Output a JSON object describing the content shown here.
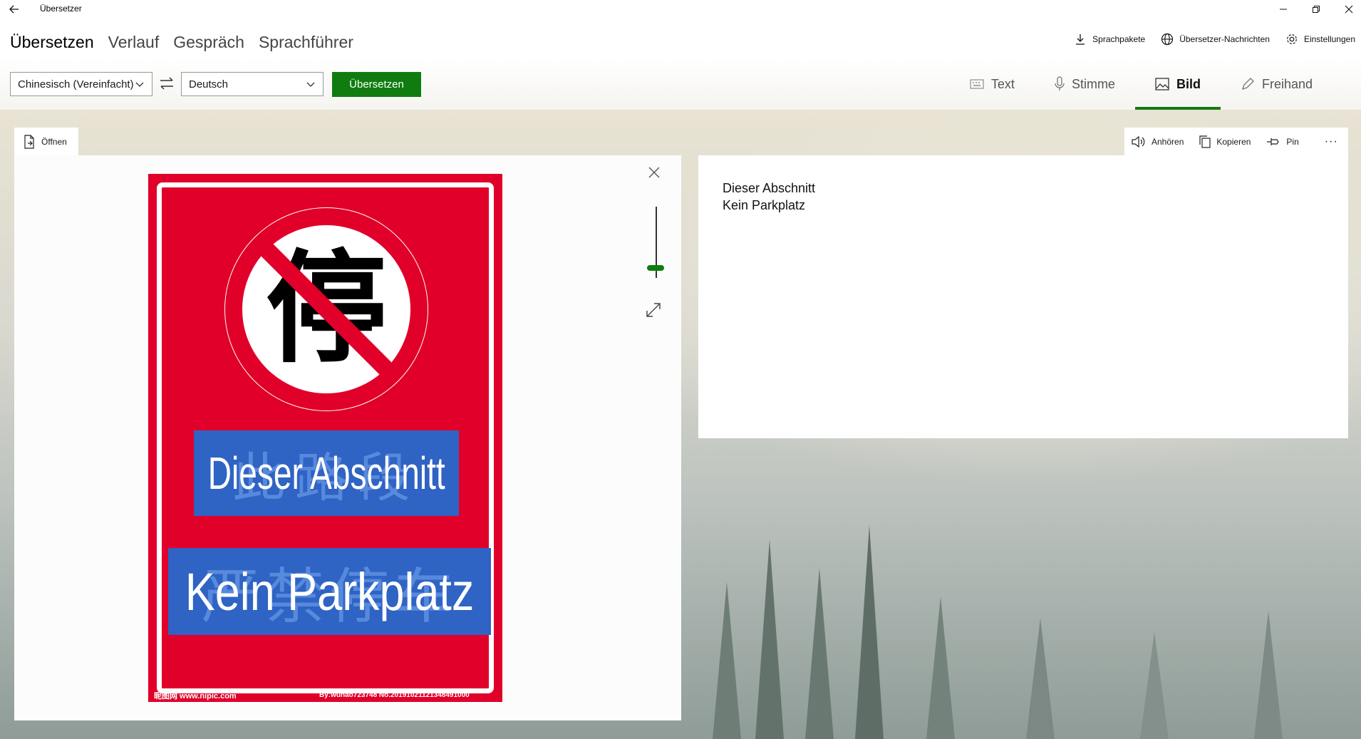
{
  "titlebar": {
    "back_label": "←",
    "title": "Übersetzer"
  },
  "nav": {
    "tabs": [
      "Übersetzen",
      "Verlauf",
      "Gespräch",
      "Sprachführer"
    ]
  },
  "header_links": {
    "packs": "Sprachpakete",
    "news": "Übersetzer-Nachrichten",
    "settings": "Einstellungen"
  },
  "toolbar": {
    "source_lang": "Chinesisch (Vereinfacht)",
    "target_lang": "Deutsch",
    "translate_label": "Übersetzen",
    "modes": [
      "Text",
      "Stimme",
      "Bild",
      "Freihand"
    ],
    "active_mode": "Bild"
  },
  "left_panel": {
    "open_label": "Öffnen"
  },
  "sign": {
    "glyph": "停",
    "overlay_line1": "Dieser Abschnitt",
    "overlay_line2": "Kein Parkplatz",
    "hidden_line1": "此路段",
    "hidden_line2": "严禁停车",
    "watermark_left": "昵图网 www.nipic.com",
    "watermark_right": "By:wuhao723748 No.20191021121348491000"
  },
  "right_panel": {
    "actions": [
      "Anhören",
      "Kopieren",
      "Pin"
    ],
    "more_label": "···",
    "result_line1": "Dieser Abschnitt",
    "result_line2": "Kein Parkplatz"
  },
  "colors": {
    "accent": "#107c10",
    "sign_red": "#e0002a",
    "overlay_blue": "#2f63c4"
  }
}
